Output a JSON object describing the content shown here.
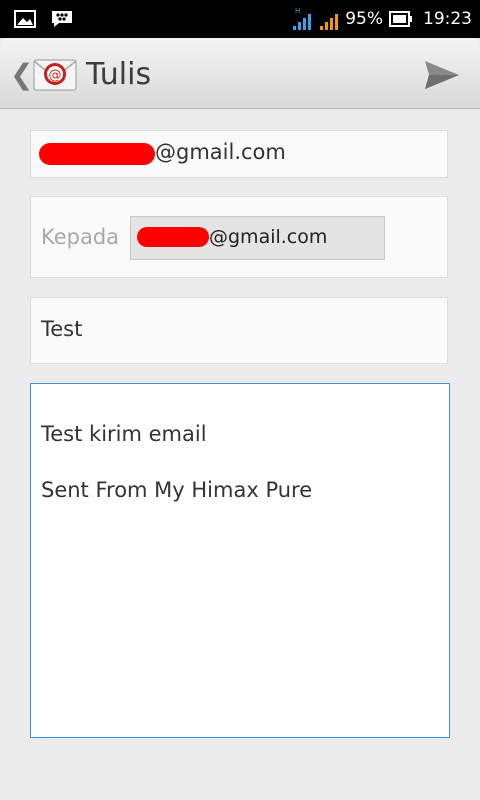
{
  "status_bar": {
    "battery_percent": "95%",
    "time": "19:23",
    "network_label": "H",
    "icons": [
      "gallery-icon",
      "bbm-icon",
      "signal-icon",
      "signal-icon",
      "battery-icon"
    ]
  },
  "action_bar": {
    "title": "Tulis",
    "app_icon": "email-app-icon",
    "send_icon": "send-icon"
  },
  "compose": {
    "from": {
      "visible_text": "@gmail.com"
    },
    "to": {
      "label": "Kepada",
      "chip_text": "@gmail.com"
    },
    "subject": "Test",
    "body_lines": [
      "Test kirim email",
      "Sent From My Himax Pure"
    ]
  },
  "colors": {
    "redaction": "#ff0000",
    "focus_border": "#3b8fd6",
    "signal_blue": "#3aa0e8",
    "signal_orange": "#f39a00"
  }
}
